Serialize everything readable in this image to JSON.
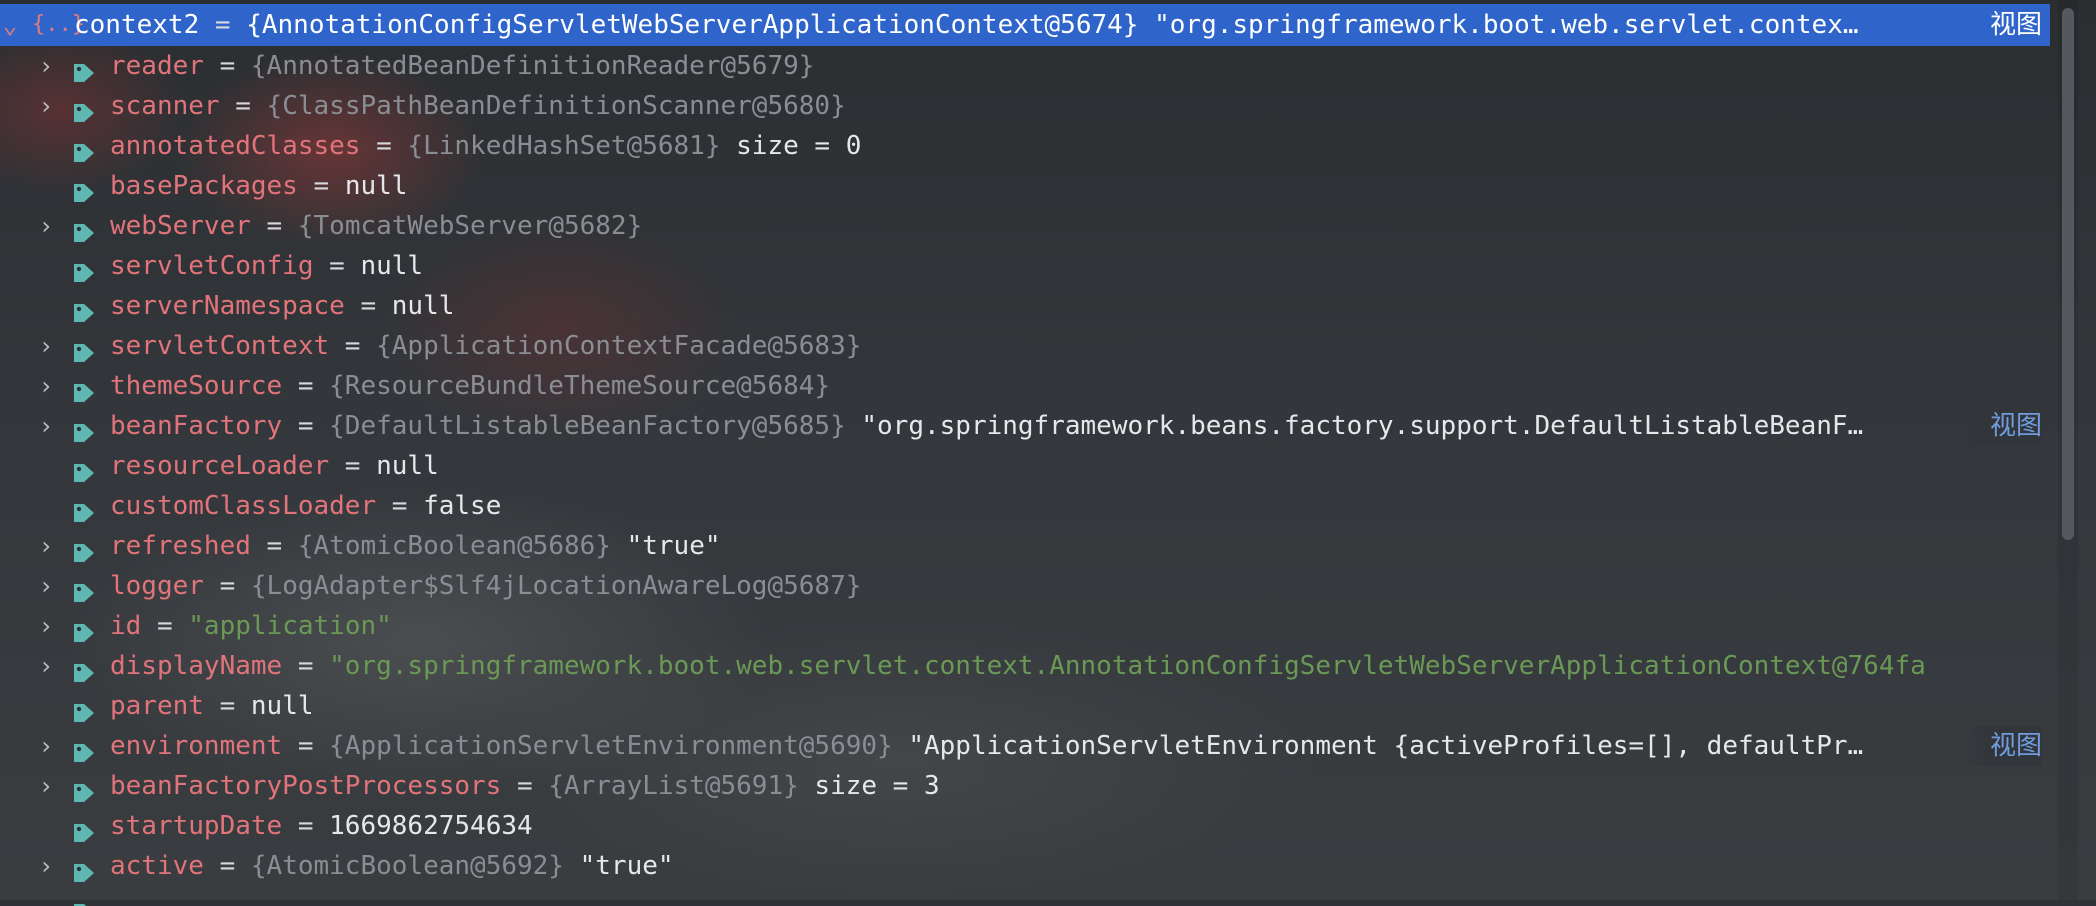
{
  "root": {
    "arrow": "⌄",
    "icon": "{..}",
    "name": "context2",
    "eq": " = ",
    "ref": "{AnnotationConfigServletWebServerApplicationContext@5674}",
    "string": " \"org.springframework.boot.web.servlet.contex…",
    "view": "视图"
  },
  "rows": [
    {
      "expandable": true,
      "name": "reader",
      "eq": " = ",
      "ref": "{AnnotatedBeanDefinitionReader@5679}",
      "extra": "",
      "string": "",
      "view": ""
    },
    {
      "expandable": true,
      "name": "scanner",
      "eq": " = ",
      "ref": "{ClassPathBeanDefinitionScanner@5680}",
      "extra": "",
      "string": "",
      "view": ""
    },
    {
      "expandable": false,
      "name": "annotatedClasses",
      "eq": " = ",
      "ref": "{LinkedHashSet@5681}",
      "extra": "  size = 0",
      "string": "",
      "view": ""
    },
    {
      "expandable": false,
      "name": "basePackages",
      "eq": " = ",
      "ref": "",
      "extra": "null",
      "string": "",
      "view": ""
    },
    {
      "expandable": true,
      "name": "webServer",
      "eq": " = ",
      "ref": "{TomcatWebServer@5682}",
      "extra": "",
      "string": "",
      "view": ""
    },
    {
      "expandable": false,
      "name": "servletConfig",
      "eq": " = ",
      "ref": "",
      "extra": "null",
      "string": "",
      "view": ""
    },
    {
      "expandable": false,
      "name": "serverNamespace",
      "eq": " = ",
      "ref": "",
      "extra": "null",
      "string": "",
      "view": ""
    },
    {
      "expandable": true,
      "name": "servletContext",
      "eq": " = ",
      "ref": "{ApplicationContextFacade@5683}",
      "extra": "",
      "string": "",
      "view": ""
    },
    {
      "expandable": true,
      "name": "themeSource",
      "eq": " = ",
      "ref": "{ResourceBundleThemeSource@5684}",
      "extra": "",
      "string": "",
      "view": ""
    },
    {
      "expandable": true,
      "name": "beanFactory",
      "eq": " = ",
      "ref": "{DefaultListableBeanFactory@5685}",
      "extra": " \"org.springframework.beans.factory.support.DefaultListableBeanF…",
      "string": "",
      "view": "视图"
    },
    {
      "expandable": false,
      "name": "resourceLoader",
      "eq": " = ",
      "ref": "",
      "extra": "null",
      "string": "",
      "view": ""
    },
    {
      "expandable": false,
      "name": "customClassLoader",
      "eq": " = ",
      "ref": "",
      "extra": "false",
      "string": "",
      "view": ""
    },
    {
      "expandable": true,
      "name": "refreshed",
      "eq": " = ",
      "ref": "{AtomicBoolean@5686}",
      "extra": " \"true\"",
      "string": "",
      "view": ""
    },
    {
      "expandable": true,
      "name": "logger",
      "eq": " = ",
      "ref": "{LogAdapter$Slf4jLocationAwareLog@5687}",
      "extra": "",
      "string": "",
      "view": ""
    },
    {
      "expandable": true,
      "name": "id",
      "eq": " = ",
      "ref": "",
      "extra": "",
      "string": "\"application\"",
      "view": ""
    },
    {
      "expandable": true,
      "name": "displayName",
      "eq": " = ",
      "ref": "",
      "extra": "",
      "string": "\"org.springframework.boot.web.servlet.context.AnnotationConfigServletWebServerApplicationContext@764fa",
      "view": ""
    },
    {
      "expandable": false,
      "name": "parent",
      "eq": " = ",
      "ref": "",
      "extra": "null",
      "string": "",
      "view": ""
    },
    {
      "expandable": true,
      "name": "environment",
      "eq": " = ",
      "ref": "{ApplicationServletEnvironment@5690}",
      "extra": " \"ApplicationServletEnvironment {activeProfiles=[], defaultPr…",
      "string": "",
      "view": "视图"
    },
    {
      "expandable": true,
      "name": "beanFactoryPostProcessors",
      "eq": " = ",
      "ref": "{ArrayList@5691}",
      "extra": "  size = 3",
      "string": "",
      "view": ""
    },
    {
      "expandable": false,
      "name": "startupDate",
      "eq": " = ",
      "ref": "",
      "extra": "1669862754634",
      "string": "",
      "view": ""
    },
    {
      "expandable": true,
      "name": "active",
      "eq": " = ",
      "ref": "{AtomicBoolean@5692}",
      "extra": " \"true\"",
      "string": "",
      "view": ""
    }
  ],
  "colors": {
    "accent": "#2f65ca",
    "field_name": "#e0747a",
    "string": "#6a9955",
    "reference": "#8a8d93",
    "link": "#6e9cde"
  }
}
